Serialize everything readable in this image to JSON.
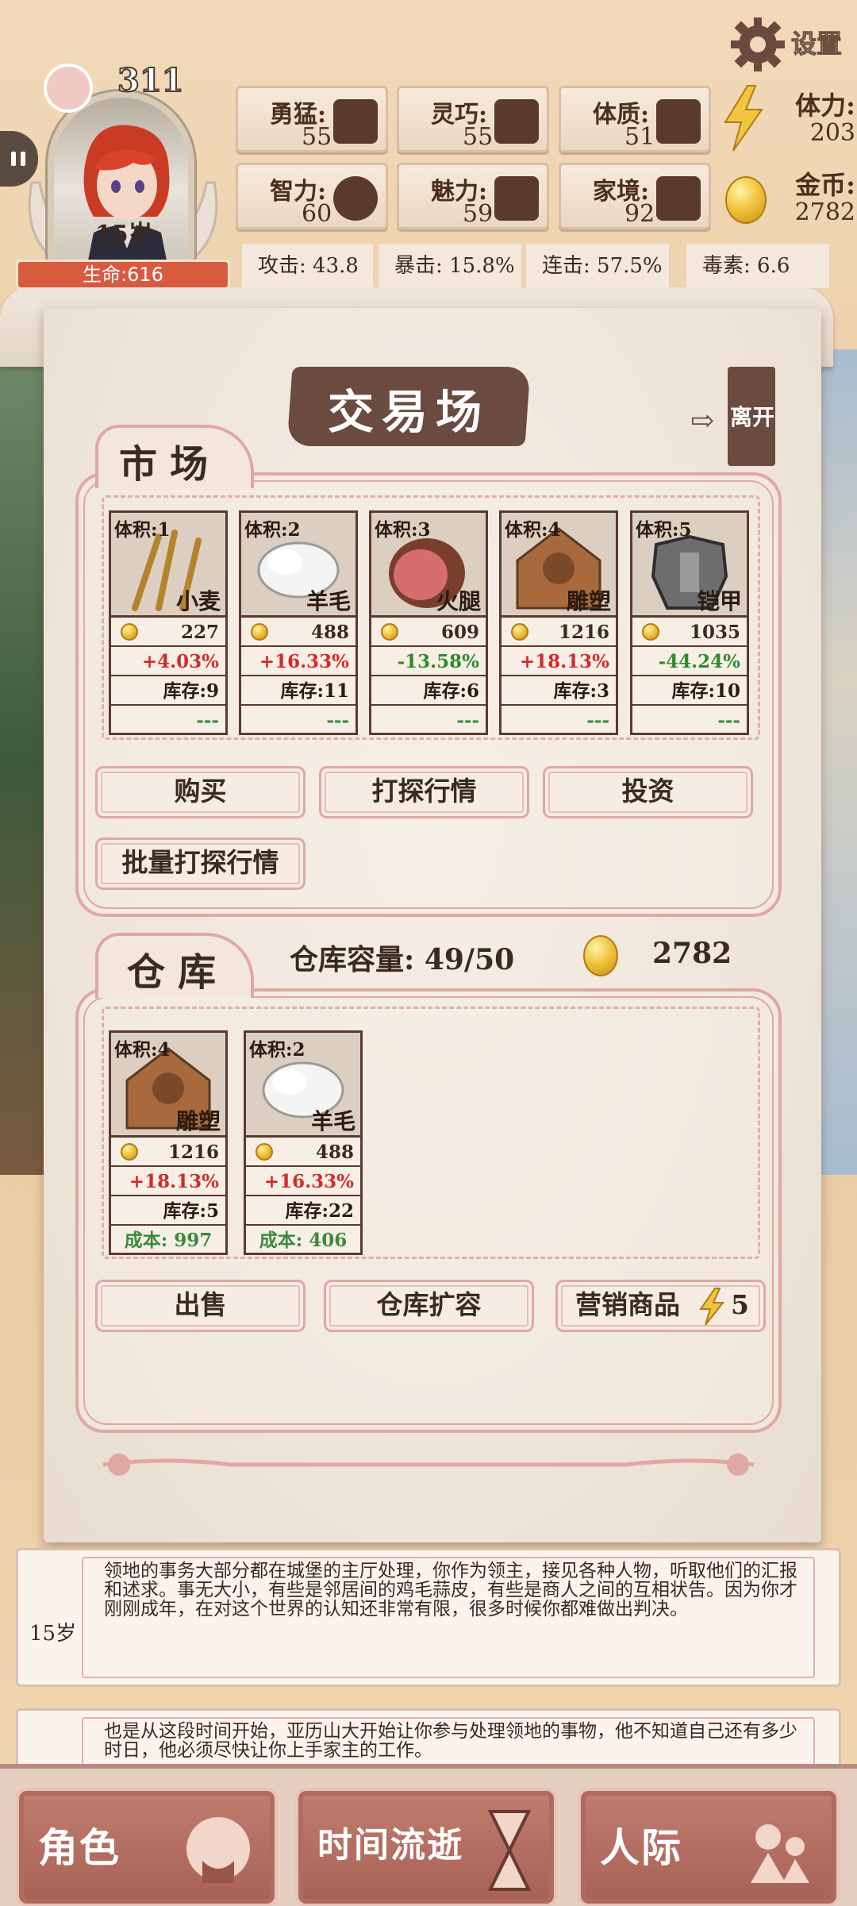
{
  "player": {
    "level": "311",
    "age": "15岁",
    "hp_label": "生命:616"
  },
  "settings": {
    "label": "设置",
    "icon": "gear-icon"
  },
  "stats": [
    {
      "label": "勇猛:",
      "value": "55",
      "icon": "fist-icon"
    },
    {
      "label": "灵巧:",
      "value": "55",
      "icon": "cloak-icon"
    },
    {
      "label": "体质:",
      "value": "51",
      "icon": "arm-muscle-icon"
    },
    {
      "label": "智力:",
      "value": "60",
      "icon": "brain-icon"
    },
    {
      "label": "魅力:",
      "value": "59",
      "icon": "flower-icon"
    },
    {
      "label": "家境:",
      "value": "92",
      "icon": "money-bag-icon"
    }
  ],
  "resources": {
    "stamina": {
      "label": "体力:",
      "value": "203",
      "icon": "lightning-icon"
    },
    "gold": {
      "label": "金币:",
      "value": "2782",
      "icon": "coin-icon"
    }
  },
  "combat": [
    "攻击: 43.8",
    "暴击: 15.8%",
    "连击: 57.5%",
    "毒素: 6.6"
  ],
  "panel": {
    "title": "交易场",
    "exit_label": "离开",
    "market": {
      "title": "市场",
      "items": [
        {
          "volume": "体积:1",
          "name": "小麦",
          "price": "227",
          "change": "+4.03%",
          "direction": "up",
          "stock": "库存:9",
          "cost": "---",
          "icon": "wheat-icon"
        },
        {
          "volume": "体积:2",
          "name": "羊毛",
          "price": "488",
          "change": "+16.33%",
          "direction": "up",
          "stock": "库存:11",
          "cost": "---",
          "icon": "wool-icon"
        },
        {
          "volume": "体积:3",
          "name": "火腿",
          "price": "609",
          "change": "-13.58%",
          "direction": "down",
          "stock": "库存:6",
          "cost": "---",
          "icon": "ham-icon"
        },
        {
          "volume": "体积:4",
          "name": "雕塑",
          "price": "1216",
          "change": "+18.13%",
          "direction": "up",
          "stock": "库存:3",
          "cost": "---",
          "icon": "sculpture-icon"
        },
        {
          "volume": "体积:5",
          "name": "铠甲",
          "price": "1035",
          "change": "-44.24%",
          "direction": "down",
          "stock": "库存:10",
          "cost": "---",
          "icon": "armor-icon"
        }
      ],
      "buttons": {
        "buy": "购买",
        "scout": "打探行情",
        "invest": "投资",
        "batch_scout": "批量打探行情"
      }
    },
    "warehouse": {
      "title": "仓库",
      "capacity": "仓库容量: 49/50",
      "gold": "2782",
      "items": [
        {
          "volume": "体积:4",
          "name": "雕塑",
          "price": "1216",
          "change": "+18.13%",
          "direction": "up",
          "stock": "库存:5",
          "cost": "成本: 997",
          "icon": "sculpture-icon"
        },
        {
          "volume": "体积:2",
          "name": "羊毛",
          "price": "488",
          "change": "+16.33%",
          "direction": "up",
          "stock": "库存:22",
          "cost": "成本: 406",
          "icon": "wool-icon"
        }
      ],
      "buttons": {
        "sell": "出售",
        "expand": "仓库扩容",
        "market": "营销商品",
        "market_cost": "5"
      }
    }
  },
  "log": [
    {
      "age": "15岁",
      "text": "领地的事务大部分都在城堡的主厅处理，你作为领主，接见各种人物，听取他们的汇报和述求。事无大小，有些是邻居间的鸡毛蒜皮，有些是商人之间的互相状告。因为你才刚刚成年，在对这个世界的认知还非常有限，很多时候你都难做出判决。"
    },
    {
      "age": "",
      "text": "也是从这段时间开始，亚历山大开始让你参与处理领地的事物，他不知道自己还有多少时日，他必须尽快让你上手家主的工作。"
    }
  ],
  "nav": [
    {
      "label": "角色",
      "icon": "character-icon"
    },
    {
      "label": "时间流逝",
      "icon": "hourglass-icon"
    },
    {
      "label": "人际",
      "icon": "people-icon"
    }
  ],
  "colors": {
    "accent": "#e0a8a2",
    "up": "#d22a2a",
    "down": "#2f8a2f",
    "banner": "#6b4a40",
    "nav": "#b06a5e"
  }
}
